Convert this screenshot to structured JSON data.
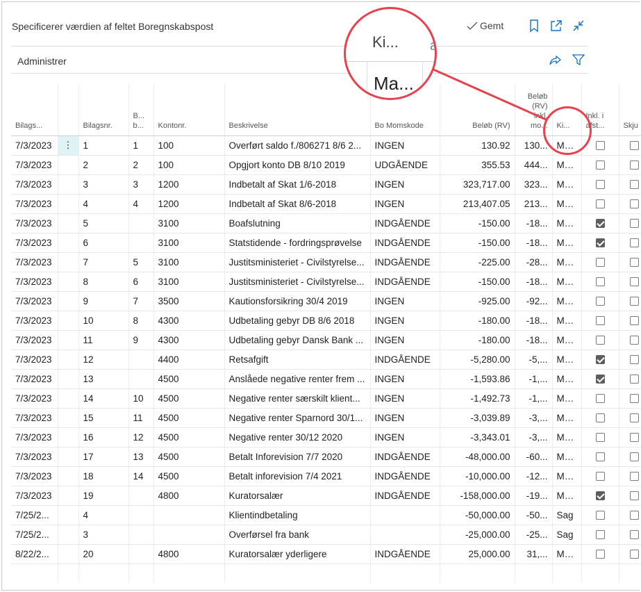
{
  "window": {
    "title": "Specificerer værdien af feltet Boregnskabspost",
    "saved_label": "Gemt"
  },
  "actions": {
    "manage_label": "Administrer"
  },
  "columns": [
    "Bilags...",
    "",
    "Bilagsnr.",
    "B... b...",
    "Kontonr.",
    "Beskrivelse",
    "Bo Momskode",
    "Beløb (RV)",
    "Beløb (RV) inkl. mo...",
    "Ki...",
    "Inkl. i afst...",
    "Skju"
  ],
  "rows": [
    [
      "7/3/2023",
      "⋮",
      "1",
      "1",
      "100",
      "Overført saldo f./806271 8/6 2...",
      "INGEN",
      "130.92",
      "130...",
      "Ma...",
      false
    ],
    [
      "7/3/2023",
      "",
      "2",
      "2",
      "100",
      "Opgjort konto DB 8/10 2019",
      "UDGÅENDE",
      "355.53",
      "444...",
      "Ma...",
      false
    ],
    [
      "7/3/2023",
      "",
      "3",
      "3",
      "1200",
      "Indbetalt af Skat 1/6-2018",
      "INGEN",
      "323,717.00",
      "323...",
      "Ma...",
      false
    ],
    [
      "7/3/2023",
      "",
      "4",
      "4",
      "1200",
      "Indbetalt af Skat 8/6-2018",
      "INGEN",
      "213,407.05",
      "213...",
      "Ma...",
      false
    ],
    [
      "7/3/2023",
      "",
      "5",
      "",
      "3100",
      "Boafslutning",
      "INDGÅENDE",
      "-150.00",
      "-18...",
      "Ma...",
      true
    ],
    [
      "7/3/2023",
      "",
      "6",
      "",
      "3100",
      "Statstidende - fordringsprøvelse",
      "INDGÅENDE",
      "-150.00",
      "-18...",
      "Ma...",
      true
    ],
    [
      "7/3/2023",
      "",
      "7",
      "5",
      "3100",
      "Justitsministeriet - Civilstyrelse...",
      "INDGÅENDE",
      "-225.00",
      "-28...",
      "Ma...",
      false
    ],
    [
      "7/3/2023",
      "",
      "8",
      "6",
      "3100",
      "Justitsministeriet - Civilstyrelse...",
      "INDGÅENDE",
      "-150.00",
      "-18...",
      "Ma...",
      false
    ],
    [
      "7/3/2023",
      "",
      "9",
      "7",
      "3500",
      "Kautionsforsikring 30/4 2019",
      "INGEN",
      "-925.00",
      "-92...",
      "Ma...",
      false
    ],
    [
      "7/3/2023",
      "",
      "10",
      "8",
      "4300",
      "Udbetaling gebyr DB 8/6 2018",
      "INGEN",
      "-180.00",
      "-18...",
      "Ma...",
      false
    ],
    [
      "7/3/2023",
      "",
      "11",
      "9",
      "4300",
      "Udbetaling gebyr Dansk Bank ...",
      "INGEN",
      "-180.00",
      "-18...",
      "Ma...",
      false
    ],
    [
      "7/3/2023",
      "",
      "12",
      "",
      "4400",
      "Retsafgift",
      "INDGÅENDE",
      "-5,280.00",
      "-5,...",
      "Ma...",
      true
    ],
    [
      "7/3/2023",
      "",
      "13",
      "",
      "4500",
      "Anslåede negative renter frem ...",
      "INGEN",
      "-1,593.86",
      "-1,...",
      "Ma...",
      true
    ],
    [
      "7/3/2023",
      "",
      "14",
      "10",
      "4500",
      "Negative renter særskilt klient...",
      "INGEN",
      "-1,492.73",
      "-1,...",
      "Ma...",
      false
    ],
    [
      "7/3/2023",
      "",
      "15",
      "11",
      "4500",
      "Negative renter Sparnord 30/1...",
      "INGEN",
      "-3,039.89",
      "-3,...",
      "Ma...",
      false
    ],
    [
      "7/3/2023",
      "",
      "16",
      "12",
      "4500",
      "Negative renter 30/12 2020",
      "INGEN",
      "-3,343.01",
      "-3,...",
      "Ma...",
      false
    ],
    [
      "7/3/2023",
      "",
      "17",
      "13",
      "4500",
      "Betalt Inforevision 7/7 2020",
      "INDGÅENDE",
      "-48,000.00",
      "-60...",
      "Ma...",
      false
    ],
    [
      "7/3/2023",
      "",
      "18",
      "14",
      "4500",
      "Betalt inforevision 7/4 2021",
      "INDGÅENDE",
      "-10,000.00",
      "-12...",
      "Ma...",
      false
    ],
    [
      "7/3/2023",
      "",
      "19",
      "",
      "4800",
      "Kuratorsalær",
      "INDGÅENDE",
      "-158,000.00",
      "-19...",
      "Ma...",
      true
    ],
    [
      "7/25/2...",
      "",
      "4",
      "",
      "",
      "Klientindbetaling",
      "",
      "-50,000.00",
      "-50...",
      "Sag",
      false
    ],
    [
      "7/25/2...",
      "",
      "3",
      "",
      "",
      "Overførsel fra bank",
      "",
      "-25,000.00",
      "-25...",
      "Sag",
      false
    ],
    [
      "8/22/2...",
      "",
      "20",
      "",
      "4800",
      "Kuratorsalær yderligere",
      "INDGÅENDE",
      "25,000.00",
      "31,...",
      "Ma...",
      false
    ]
  ],
  "zoom": {
    "header_text": "Ki...",
    "cell_text": "Ma...",
    "side_text": "a"
  },
  "colors": {
    "accent": "#0f6fc6",
    "highlight": "#e8414e",
    "selected_cell": "#dff3f5"
  }
}
